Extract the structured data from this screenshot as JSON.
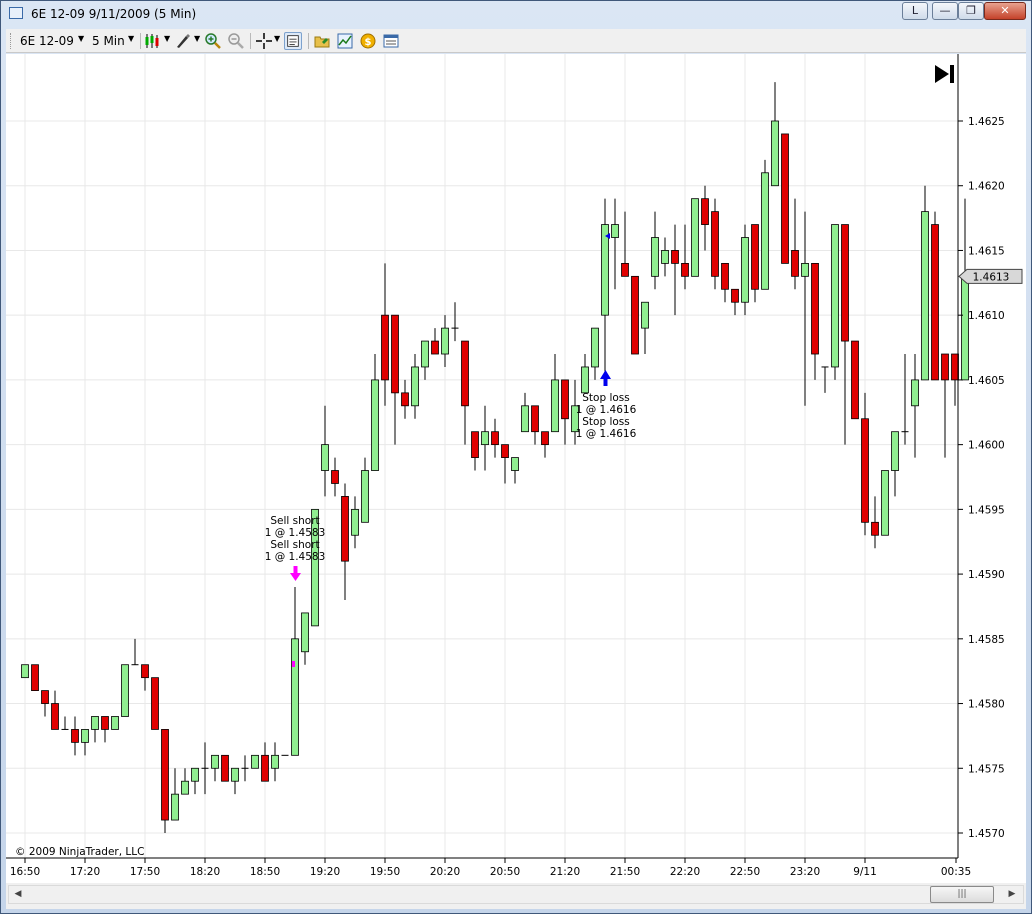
{
  "window": {
    "title": "6E 12-09  9/11/2009 (5 Min)",
    "buttons": {
      "link": "L",
      "minimize": "—",
      "restore": "❐",
      "close": "✕"
    }
  },
  "toolbar": {
    "instrument": "6E 12-09",
    "interval": "5 Min",
    "icons": [
      "bar-type-icon",
      "draw-icon",
      "zoom-in-icon",
      "zoom-out-icon",
      "crosshair-icon",
      "data-box-icon",
      "templates-icon",
      "indicators-icon",
      "strategies-icon",
      "properties-icon"
    ]
  },
  "chart": {
    "copyright": "© 2009 NinjaTrader, LLC",
    "last_price": "1.4613",
    "colors": {
      "up": "#90ee90",
      "down": "#e00000",
      "sell_marker": "#ff00ff",
      "stop_marker": "#0000ee"
    },
    "annotations": {
      "sell1a": "Sell short",
      "sell1b": "1 @ 1.4583",
      "sell2a": "Sell short",
      "sell2b": "1 @ 1.4583",
      "stop1a": "Stop loss",
      "stop1b": "1 @ 1.4616",
      "stop2a": "Stop loss",
      "stop2b": "1 @ 1.4616"
    }
  },
  "chart_data": {
    "type": "candlestick",
    "ylim": [
      1.4568,
      1.4635
    ],
    "y_ticks": [
      "1.4570",
      "1.4575",
      "1.4580",
      "1.4585",
      "1.4590",
      "1.4595",
      "1.4600",
      "1.4605",
      "1.4610",
      "1.4615",
      "1.4620",
      "1.4625"
    ],
    "x_ticks": [
      "16:50",
      "17:20",
      "17:50",
      "18:20",
      "18:50",
      "19:20",
      "19:50",
      "20:20",
      "20:50",
      "21:20",
      "21:50",
      "22:20",
      "22:50",
      "23:20",
      "9/11",
      "00:35"
    ],
    "bars": [
      [
        1.4582,
        1.4583,
        1.4582,
        1.4583
      ],
      [
        1.4583,
        1.4583,
        1.4581,
        1.4581
      ],
      [
        1.4581,
        1.4581,
        1.4579,
        1.458
      ],
      [
        1.458,
        1.4581,
        1.4578,
        1.4578
      ],
      [
        1.4578,
        1.4579,
        1.4578,
        1.4578
      ],
      [
        1.4578,
        1.4579,
        1.4576,
        1.4577
      ],
      [
        1.4577,
        1.4578,
        1.4576,
        1.4578
      ],
      [
        1.4578,
        1.4579,
        1.4577,
        1.4579
      ],
      [
        1.4579,
        1.4579,
        1.4577,
        1.4578
      ],
      [
        1.4578,
        1.4579,
        1.4578,
        1.4579
      ],
      [
        1.4579,
        1.4583,
        1.4579,
        1.4583
      ],
      [
        1.4583,
        1.4585,
        1.4583,
        1.4583
      ],
      [
        1.4583,
        1.4583,
        1.4581,
        1.4582
      ],
      [
        1.4582,
        1.4582,
        1.4578,
        1.4578
      ],
      [
        1.4578,
        1.4578,
        1.457,
        1.4571
      ],
      [
        1.4571,
        1.4575,
        1.4571,
        1.4573
      ],
      [
        1.4573,
        1.4575,
        1.4573,
        1.4574
      ],
      [
        1.4574,
        1.4574,
        1.4573,
        1.4575
      ],
      [
        1.4575,
        1.4577,
        1.4573,
        1.4575
      ],
      [
        1.4575,
        1.4576,
        1.4574,
        1.4576
      ],
      [
        1.4576,
        1.4576,
        1.4574,
        1.4574
      ],
      [
        1.4574,
        1.4575,
        1.4573,
        1.4575
      ],
      [
        1.4575,
        1.4576,
        1.4574,
        1.4575
      ],
      [
        1.4575,
        1.4576,
        1.4575,
        1.4576
      ],
      [
        1.4576,
        1.4577,
        1.4574,
        1.4574
      ],
      [
        1.4575,
        1.4577,
        1.4574,
        1.4576
      ],
      [
        1.4576,
        1.4576,
        1.4576,
        1.4576
      ],
      [
        1.4576,
        1.4589,
        1.4576,
        1.4585
      ],
      [
        1.4584,
        1.4587,
        1.4583,
        1.4587
      ],
      [
        1.4586,
        1.4595,
        1.4586,
        1.4595
      ],
      [
        1.4598,
        1.4603,
        1.4596,
        1.46
      ],
      [
        1.4598,
        1.4599,
        1.4596,
        1.4597
      ],
      [
        1.4596,
        1.4597,
        1.4588,
        1.4591
      ],
      [
        1.4593,
        1.4596,
        1.4592,
        1.4595
      ],
      [
        1.4594,
        1.4599,
        1.4594,
        1.4598
      ],
      [
        1.4598,
        1.4607,
        1.4598,
        1.4605
      ],
      [
        1.461,
        1.4614,
        1.4603,
        1.4605
      ],
      [
        1.461,
        1.461,
        1.46,
        1.4604
      ],
      [
        1.4604,
        1.4605,
        1.4602,
        1.4603
      ],
      [
        1.4603,
        1.4607,
        1.4602,
        1.4606
      ],
      [
        1.4606,
        1.4608,
        1.4605,
        1.4608
      ],
      [
        1.4608,
        1.4609,
        1.4607,
        1.4607
      ],
      [
        1.4607,
        1.461,
        1.4606,
        1.4609
      ],
      [
        1.4609,
        1.4611,
        1.4608,
        1.4609
      ],
      [
        1.4608,
        1.4608,
        1.46,
        1.4603
      ],
      [
        1.4601,
        1.4601,
        1.4598,
        1.4599
      ],
      [
        1.46,
        1.4603,
        1.4598,
        1.4601
      ],
      [
        1.4601,
        1.4602,
        1.4599,
        1.46
      ],
      [
        1.46,
        1.46,
        1.4597,
        1.4599
      ],
      [
        1.4598,
        1.4599,
        1.4597,
        1.4599
      ],
      [
        1.4601,
        1.4604,
        1.4601,
        1.4603
      ],
      [
        1.4603,
        1.4603,
        1.46,
        1.4601
      ],
      [
        1.4601,
        1.4601,
        1.4599,
        1.46
      ],
      [
        1.4601,
        1.4607,
        1.4601,
        1.4605
      ],
      [
        1.4605,
        1.4605,
        1.46,
        1.4602
      ],
      [
        1.4601,
        1.4605,
        1.46,
        1.4603
      ],
      [
        1.4604,
        1.4607,
        1.4604,
        1.4606
      ],
      [
        1.4606,
        1.4608,
        1.4605,
        1.4609
      ],
      [
        1.461,
        1.4619,
        1.4605,
        1.4617
      ],
      [
        1.4616,
        1.4619,
        1.4612,
        1.4617
      ],
      [
        1.4614,
        1.4618,
        1.4613,
        1.4613
      ],
      [
        1.4613,
        1.4613,
        1.4607,
        1.4607
      ],
      [
        1.4609,
        1.4611,
        1.4607,
        1.4611
      ],
      [
        1.4613,
        1.4618,
        1.4612,
        1.4616
      ],
      [
        1.4614,
        1.4616,
        1.4613,
        1.4615
      ],
      [
        1.4615,
        1.4617,
        1.461,
        1.4614
      ],
      [
        1.4614,
        1.4617,
        1.4612,
        1.4613
      ],
      [
        1.4613,
        1.4619,
        1.4613,
        1.4619
      ],
      [
        1.4619,
        1.462,
        1.4615,
        1.4617
      ],
      [
        1.4618,
        1.4619,
        1.4612,
        1.4613
      ],
      [
        1.4614,
        1.4614,
        1.4611,
        1.4612
      ],
      [
        1.4612,
        1.4612,
        1.461,
        1.4611
      ],
      [
        1.4611,
        1.4617,
        1.461,
        1.4616
      ],
      [
        1.4617,
        1.4617,
        1.4611,
        1.4612
      ],
      [
        1.4612,
        1.4622,
        1.4612,
        1.4621
      ],
      [
        1.462,
        1.4628,
        1.462,
        1.4625
      ],
      [
        1.4624,
        1.4624,
        1.4614,
        1.4614
      ],
      [
        1.4615,
        1.4619,
        1.4612,
        1.4613
      ],
      [
        1.4613,
        1.4618,
        1.4603,
        1.4614
      ],
      [
        1.4614,
        1.4614,
        1.4605,
        1.4607
      ],
      [
        1.4606,
        1.4606,
        1.4604,
        1.4606
      ],
      [
        1.4606,
        1.4617,
        1.4605,
        1.4617
      ],
      [
        1.4617,
        1.4617,
        1.46,
        1.4608
      ],
      [
        1.4608,
        1.4608,
        1.4602,
        1.4602
      ],
      [
        1.4602,
        1.4604,
        1.4593,
        1.4594
      ],
      [
        1.4594,
        1.4596,
        1.4592,
        1.4593
      ],
      [
        1.4593,
        1.4596,
        1.4593,
        1.4598
      ],
      [
        1.4598,
        1.4601,
        1.4596,
        1.4601
      ],
      [
        1.4601,
        1.4607,
        1.46,
        1.4601
      ],
      [
        1.4603,
        1.4607,
        1.4599,
        1.4605
      ],
      [
        1.4605,
        1.462,
        1.4605,
        1.4618
      ],
      [
        1.4617,
        1.4618,
        1.4605,
        1.4605
      ],
      [
        1.4607,
        1.4607,
        1.4599,
        1.4605
      ],
      [
        1.4607,
        1.4607,
        1.4603,
        1.4605
      ],
      [
        1.4605,
        1.4619,
        1.4605,
        1.4613
      ]
    ]
  }
}
